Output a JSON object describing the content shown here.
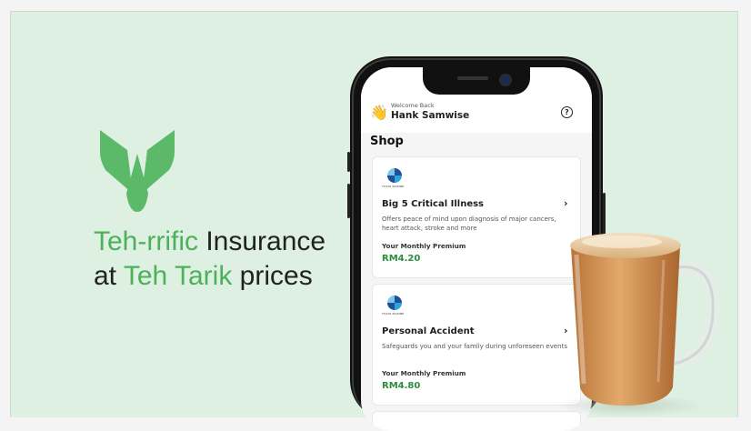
{
  "hero": {
    "headline_line1_green": "Teh-rrific",
    "headline_line1_rest": " Insurance",
    "headline_line2_start": "at ",
    "headline_line2_green": "Teh Tarik",
    "headline_line2_end": " prices"
  },
  "app": {
    "welcome_text": "Welcome Back",
    "user_name": "Hank Samwise",
    "wave_emoji": "👋",
    "help_icon": "?",
    "shop_title": "Shop",
    "cards": [
      {
        "insurer": "TOKIO MARINE",
        "title": "Big 5 Critical Illness",
        "description": "Offers peace of mind upon diagnosis of major cancers, heart attack, stroke and more",
        "premium_label": "Your Monthly Premium",
        "price": "RM4.20"
      },
      {
        "insurer": "TOKIO MARINE",
        "title": "Personal Accident",
        "description": "Safeguards you and your family during unforeseen events",
        "premium_label": "Your Monthly Premium",
        "price": "RM4.80"
      }
    ]
  },
  "colors": {
    "brand_green": "#4cb15a",
    "price_green": "#2e8b3f",
    "background": "#def0e2"
  }
}
